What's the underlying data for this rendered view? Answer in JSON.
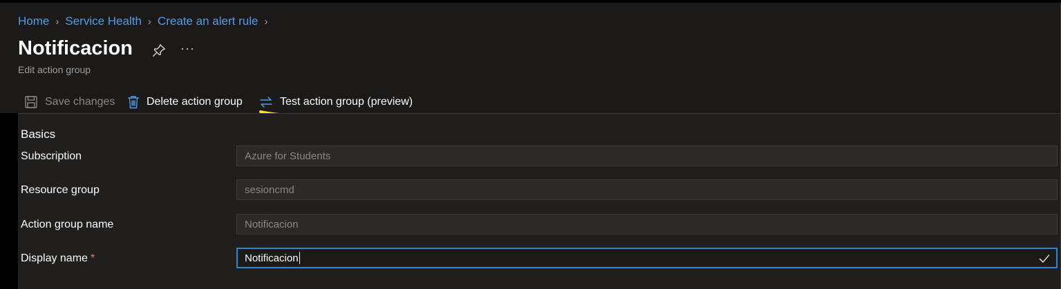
{
  "breadcrumb": {
    "items": [
      "Home",
      "Service Health",
      "Create an alert rule"
    ]
  },
  "header": {
    "title": "Notificacion",
    "subtitle": "Edit action group",
    "more_label": "···"
  },
  "toolbar": {
    "save_label": "Save changes",
    "delete_label": "Delete action group",
    "test_label": "Test action group (preview)"
  },
  "form": {
    "section_title": "Basics",
    "fields": [
      {
        "label": "Subscription",
        "value": "Azure for Students",
        "required": false
      },
      {
        "label": "Resource group",
        "value": "sesioncmd",
        "required": false
      },
      {
        "label": "Action group name",
        "value": "Notificacion",
        "required": false
      },
      {
        "label": "Display name",
        "value": "Notificacion",
        "required": true,
        "required_mark": "*"
      }
    ]
  },
  "colors": {
    "link": "#4f9de8",
    "accent": "#2b88d8",
    "highlight": "#ffe500",
    "required": "#f1707b",
    "background": "#1b1a19"
  },
  "icons": [
    "save-icon",
    "delete-icon",
    "test-icon",
    "pin-icon",
    "more-icon",
    "checkmark-icon",
    "chevron-right-icon"
  ]
}
